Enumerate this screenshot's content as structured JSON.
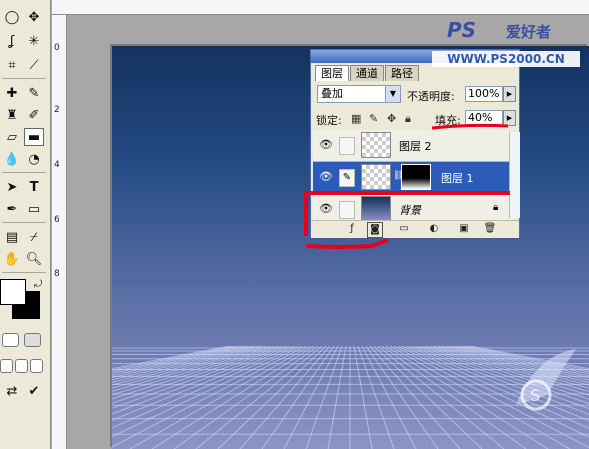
{
  "ruler": {
    "left_marks": [
      "0",
      "2",
      "4",
      "6",
      "8"
    ]
  },
  "layers_panel": {
    "tabs": [
      "图层",
      "通道",
      "路径"
    ],
    "blend_mode": "叠加",
    "opacity_label": "不透明度:",
    "opacity_value": "100%",
    "lock_label": "锁定:",
    "fill_label": "填充:",
    "fill_value": "40%",
    "layers": [
      {
        "name": "图层 2",
        "visible": true,
        "selected": false
      },
      {
        "name": "图层 1",
        "visible": true,
        "selected": true
      },
      {
        "name": "背景",
        "visible": true,
        "selected": false,
        "locked": true
      }
    ]
  },
  "watermark": {
    "brand": "PS",
    "brand_suffix": "爱好者",
    "url": "WWW.PS2000.CN"
  },
  "colors": {
    "canvas_top": "#13325f",
    "canvas_bottom": "#8d93c4",
    "selection_blue": "#2d5bb8",
    "annotation_red": "#e8001a"
  }
}
